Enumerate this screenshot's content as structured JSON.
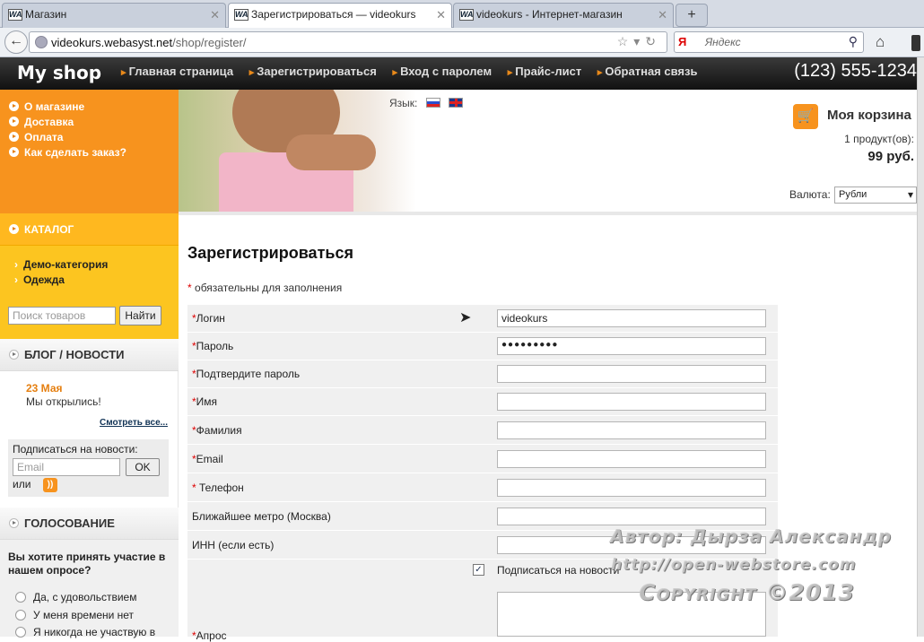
{
  "browser": {
    "tabs": [
      {
        "label": "Магазин",
        "favicon": "WA"
      },
      {
        "label": "Зарегистрироваться — videokurs",
        "favicon": "WA"
      },
      {
        "label": "videokurs - Интернет-магазин",
        "favicon": "WA"
      }
    ],
    "new_tab": "+",
    "url_domain": "videokurs.webasyst.net",
    "url_path": "/shop/register/",
    "search_placeholder": "Яндекс",
    "search_engine": "Я"
  },
  "site": {
    "logo": "My shop",
    "nav": [
      "Главная страница",
      "Зарегистрироваться",
      "Вход с паролем",
      "Прайс-лист",
      "Обратная связь"
    ],
    "phone": "(123) 555-1234"
  },
  "sidebar": {
    "info_links": [
      "О магазине",
      "Доставка",
      "Оплата",
      "Как сделать заказ?"
    ],
    "catalog_title": "КАТАЛОГ",
    "categories": [
      "Демо-категория",
      "Одежда"
    ],
    "search_placeholder": "Поиск товаров",
    "search_button": "Найти",
    "blog_title": "БЛОГ / НОВОСТИ",
    "blog_date": "23 Мая",
    "blog_text": "Мы открылись!",
    "blog_more": "Смотреть все...",
    "subscribe_label": "Подписаться на новости:",
    "subscribe_placeholder": "Email",
    "subscribe_button": "OK",
    "or_label": "или",
    "vote_title": "ГОЛОСОВАНИЕ",
    "vote_question": "Вы хотите принять участие в нашем опросе?",
    "vote_options": [
      "Да, с удовольствием",
      "У меня времени нет",
      "Я никогда не участвую в"
    ]
  },
  "header": {
    "language_label": "Язык:",
    "cart_title": "Моя корзина",
    "cart_count": "1 продукт(ов):",
    "cart_sum": "99 руб.",
    "currency_label": "Валюта:",
    "currency_value": "Рубли"
  },
  "form": {
    "title": "Зарегистрироваться",
    "required_note": "обязательны для заполнения",
    "fields": [
      {
        "label": "Логин",
        "required": "*",
        "value": "videokurs"
      },
      {
        "label": "Пароль",
        "required": "*",
        "value": "●●●●●●●●●"
      },
      {
        "label": "Подтвердите пароль",
        "required": "*",
        "value": ""
      },
      {
        "label": "Имя",
        "required": "*",
        "value": ""
      },
      {
        "label": "Фамилия",
        "required": "*",
        "value": ""
      },
      {
        "label": "Email",
        "required": "*",
        "value": ""
      },
      {
        "label": " Телефон",
        "required": "*",
        "value": ""
      },
      {
        "label": "Ближайшее метро (Москва)",
        "required": "",
        "value": ""
      },
      {
        "label": "ИНН (если есть)",
        "required": "",
        "value": ""
      }
    ],
    "subscribe_checkbox": "Подписаться на новости",
    "subscribe_checked": "✓",
    "poll_label": "Апрос"
  },
  "watermark": {
    "author": "Автор: Дырза Александр",
    "site": "http://open-webstore.com",
    "copyright": "Copyright ©2013"
  },
  "colors": {
    "orange": "#f7931e",
    "yellow": "#fcc520",
    "header_dark": "#1a1a1a"
  }
}
